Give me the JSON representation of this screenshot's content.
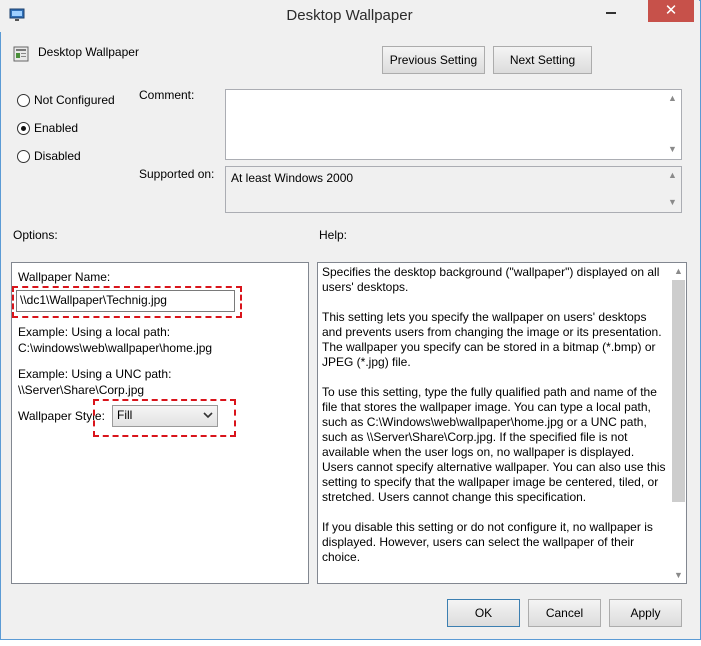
{
  "window": {
    "title": "Desktop Wallpaper",
    "close_glyph": "✕"
  },
  "header": {
    "policy_name": "Desktop Wallpaper"
  },
  "nav": {
    "previous": "Previous Setting",
    "next": "Next Setting"
  },
  "state": {
    "options": [
      {
        "label": "Not Configured",
        "checked": false
      },
      {
        "label": "Enabled",
        "checked": true
      },
      {
        "label": "Disabled",
        "checked": false
      }
    ]
  },
  "comment": {
    "label": "Comment:",
    "value": ""
  },
  "supported": {
    "label": "Supported on:",
    "value": "At least Windows 2000"
  },
  "options_section": {
    "label": "Options:",
    "wallpaper_name_label": "Wallpaper Name:",
    "wallpaper_name_value": "\\\\dc1\\Wallpaper\\Technig.jpg",
    "example_local_label": "Example: Using a local path:",
    "example_local_path": "C:\\windows\\web\\wallpaper\\home.jpg",
    "example_unc_label": "Example: Using a UNC path:",
    "example_unc_path": "\\\\Server\\Share\\Corp.jpg",
    "style_label": "Wallpaper Style:",
    "style_value": "Fill"
  },
  "help": {
    "label": "Help:",
    "paragraphs": [
      "Specifies the desktop background (\"wallpaper\") displayed on all users' desktops.",
      "This setting lets you specify the wallpaper on users' desktops and prevents users from changing the image or its presentation. The wallpaper you specify can be stored in a bitmap (*.bmp) or JPEG (*.jpg) file.",
      "To use this setting, type the fully qualified path and name of the file that stores the wallpaper image. You can type a local path, such as C:\\Windows\\web\\wallpaper\\home.jpg or a UNC path, such as \\\\Server\\Share\\Corp.jpg. If the specified file is not available when the user logs on, no wallpaper is displayed. Users cannot specify alternative wallpaper. You can also use this setting to specify that the wallpaper image be centered, tiled, or stretched. Users cannot change this specification.",
      "If you disable this setting or do not configure it, no wallpaper is displayed. However, users can select the wallpaper of their choice."
    ]
  },
  "footer": {
    "ok": "OK",
    "cancel": "Cancel",
    "apply": "Apply"
  },
  "icons": {
    "app": "policy-monitor-icon",
    "setting": "policy-setting-icon",
    "minimize": "minimize-icon",
    "close": "close-icon",
    "dropdown": "chevron-down-icon",
    "scroll_up": "scroll-up-arrow-icon",
    "scroll_down": "scroll-down-arrow-icon"
  },
  "colors": {
    "accent_border": "#5b9bd5",
    "close": "#c7514a",
    "highlight": "#d9141b"
  }
}
